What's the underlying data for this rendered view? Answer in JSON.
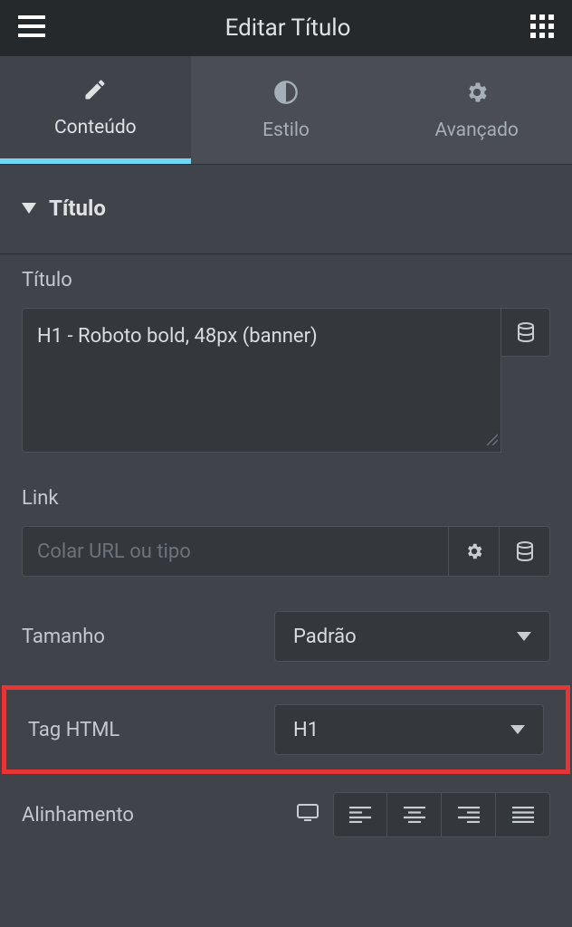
{
  "header": {
    "title": "Editar Título"
  },
  "tabs": {
    "content": "Conteúdo",
    "style": "Estilo",
    "advanced": "Avançado"
  },
  "section": {
    "title": "Título"
  },
  "fields": {
    "title_label": "Título",
    "title_value": "H1 - Roboto bold, 48px (banner)",
    "link_label": "Link",
    "link_placeholder": "Colar URL ou tipo",
    "size_label": "Tamanho",
    "size_value": "Padrão",
    "htmltag_label": "Tag HTML",
    "htmltag_value": "H1",
    "alignment_label": "Alinhamento"
  }
}
